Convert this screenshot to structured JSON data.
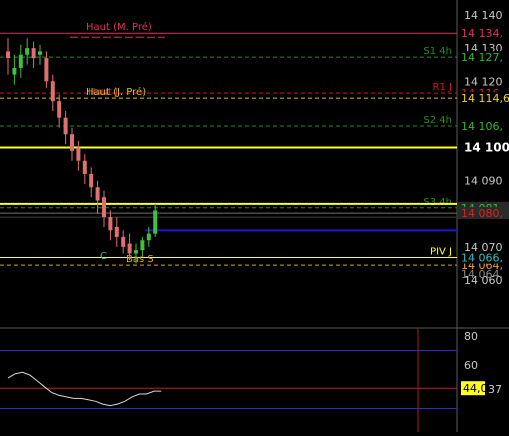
{
  "price_panel": {
    "axis_ticks": [
      {
        "label": "14 140",
        "value": 14140
      },
      {
        "label": "14 130",
        "value": 14130
      },
      {
        "label": "14 120",
        "value": 14120
      },
      {
        "label": "14 100",
        "value": 14100,
        "bold": true
      },
      {
        "label": "14 090",
        "value": 14090
      },
      {
        "label": "14 070",
        "value": 14070
      },
      {
        "label": "14 060",
        "value": 14060
      }
    ],
    "levels": [
      {
        "key": "haut-m-pre",
        "name": "Haut (M. Pré)",
        "value": 14134.5,
        "price_tag": "14 134,",
        "color": "#e0305a",
        "style": "solid",
        "label_side": "left",
        "tag_bg": "#000",
        "tag_color": "#e0305a"
      },
      {
        "key": "s1-4h",
        "name": "S1 4h",
        "value": 14127.3,
        "price_tag": "14 127,",
        "color": "#1f8f1f",
        "style": "dash",
        "label_side": "right",
        "tag_bg": "#000",
        "tag_color": "#2fb52f"
      },
      {
        "key": "r1-j",
        "name": "R1 J",
        "value": 14116.4,
        "price_tag": "14 116,",
        "color": "#d01818",
        "style": "dash",
        "label_side": "right",
        "tag_bg": "#000",
        "tag_color": "#e02020"
      },
      {
        "key": "haut-j-pre",
        "name": "Haut (J. Pré)",
        "value": 14114.9,
        "price_tag": "14 114,6",
        "color": "#d8c020",
        "style": "dash",
        "label_side": "left",
        "tag_bg": "#000",
        "tag_color": "#f0d020"
      },
      {
        "key": "s2-4h",
        "name": "S2 4h",
        "value": 14106.5,
        "price_tag": "14 106,",
        "color": "#1f8f1f",
        "style": "dash",
        "label_side": "right",
        "tag_bg": "#000",
        "tag_color": "#2fb52f"
      },
      {
        "key": "s3-4h",
        "name": "S3 4h",
        "value": 14081.8,
        "price_tag": "14 081,",
        "color": "#1f8f1f",
        "style": "dash",
        "label_side": "right",
        "tag_bg": "#2a2a2a",
        "tag_color": "#30c030"
      },
      {
        "key": "current",
        "name": "",
        "value": 14080.2,
        "price_tag": "14 080,",
        "color": "#707070",
        "style": "solid",
        "label_side": "none",
        "tag_bg": "#2a2a2a",
        "tag_color": "#e02020"
      },
      {
        "key": "bas-s",
        "name": "Bas S",
        "value": 14064.5,
        "price_tag": "14 064,",
        "color": "#e0a020",
        "style": "dash",
        "label_side": "mid",
        "tag_bg": "#000",
        "tag_color": "#f0a020"
      },
      {
        "key": "piv-j",
        "name": "PIV J",
        "value": 14066.8,
        "price_tag": "14 066,",
        "color": "#ffff40",
        "style": "solid",
        "label_side": "right",
        "tag_bg": "#000",
        "tag_color": "#30c0c0"
      }
    ],
    "extra_tags": [
      {
        "text": "14 064,",
        "color": "#888888"
      }
    ],
    "overlay_labels": {
      "stacked_left": "Haut (J. Pré)",
      "stacked_left_overlay": "Haut J",
      "lower_mid": "Bas S",
      "lower_small": "C"
    }
  },
  "oscillator": {
    "axis_ticks": [
      {
        "label": "80",
        "value": 80
      },
      {
        "label": "60",
        "value": 60
      }
    ],
    "current_tag": "44,0",
    "current_value": 44.0,
    "side_tag": "37",
    "level_upper": 70,
    "level_mid": 44,
    "level_lower": 30,
    "line_values": [
      51,
      54,
      55,
      53,
      49,
      45,
      41,
      39,
      38,
      37,
      37,
      36,
      35,
      33,
      32,
      33,
      35,
      38,
      40,
      40,
      42,
      42
    ]
  },
  "candles": [
    {
      "o": 14129,
      "h": 14133,
      "c": 14127,
      "l": 14122
    },
    {
      "o": 14122,
      "h": 14128,
      "c": 14124,
      "l": 14119
    },
    {
      "o": 14124,
      "h": 14131,
      "c": 14128,
      "l": 14121
    },
    {
      "o": 14128,
      "h": 14133,
      "c": 14130,
      "l": 14125
    },
    {
      "o": 14130,
      "h": 14132,
      "c": 14127,
      "l": 14124
    },
    {
      "o": 14128,
      "h": 14131,
      "c": 14129,
      "l": 14125
    },
    {
      "o": 14127,
      "h": 14129,
      "c": 14120,
      "l": 14118
    },
    {
      "o": 14120,
      "h": 14122,
      "c": 14114,
      "l": 14111
    },
    {
      "o": 14114,
      "h": 14116,
      "c": 14109,
      "l": 14106
    },
    {
      "o": 14109,
      "h": 14111,
      "c": 14104,
      "l": 14101
    },
    {
      "o": 14104,
      "h": 14106,
      "c": 14099,
      "l": 14096
    },
    {
      "o": 14100,
      "h": 14102,
      "c": 14096,
      "l": 14093
    },
    {
      "o": 14096,
      "h": 14098,
      "c": 14092,
      "l": 14089
    },
    {
      "o": 14092,
      "h": 14094,
      "c": 14088,
      "l": 14085
    },
    {
      "o": 14088,
      "h": 14090,
      "c": 14084,
      "l": 14080
    },
    {
      "o": 14085,
      "h": 14087,
      "c": 14079,
      "l": 14076
    },
    {
      "o": 14079,
      "h": 14081,
      "c": 14075,
      "l": 14072
    },
    {
      "o": 14076,
      "h": 14079,
      "c": 14073,
      "l": 14070
    },
    {
      "o": 14073,
      "h": 14075,
      "c": 14070,
      "l": 14068
    },
    {
      "o": 14071,
      "h": 14074,
      "c": 14068,
      "l": 14066
    },
    {
      "o": 14068,
      "h": 14071,
      "c": 14069,
      "l": 14065
    },
    {
      "o": 14069,
      "h": 14073,
      "c": 14072,
      "l": 14067
    },
    {
      "o": 14072,
      "h": 14076,
      "c": 14074,
      "l": 14070
    },
    {
      "o": 14074,
      "h": 14083,
      "c": 14081,
      "l": 14073
    }
  ]
}
